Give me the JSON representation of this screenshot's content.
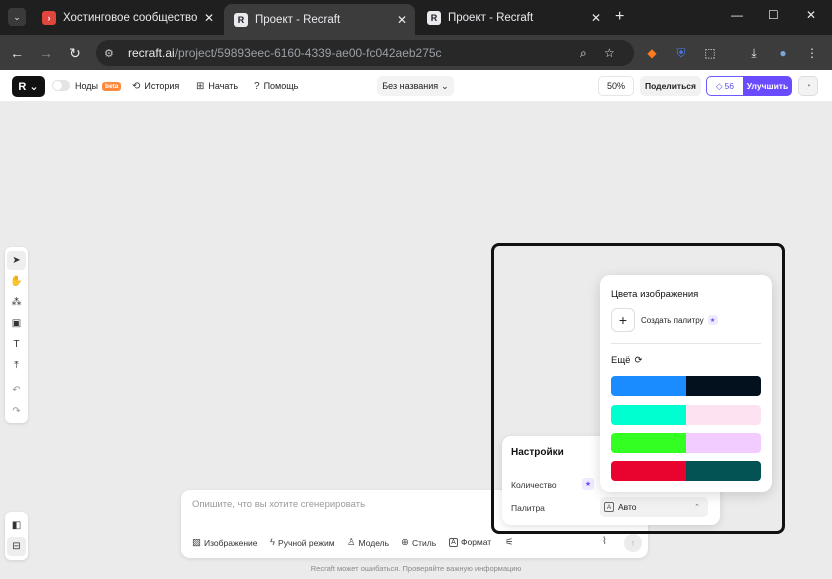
{
  "browser": {
    "menu_glyph": "⌄",
    "tabs": [
      {
        "title": "Хостинговое сообщество «Tim",
        "close": "✕",
        "favicon": "›"
      },
      {
        "title": "Проект - Recraft",
        "close": "✕",
        "favicon": "R"
      },
      {
        "title": "Проект - Recraft",
        "close": "✕",
        "favicon": "R"
      }
    ],
    "new_tab": "+",
    "window_controls": {
      "minimize": "—",
      "maximize": "☐",
      "close": "✕"
    },
    "nav": {
      "back": "←",
      "forward": "→",
      "reload": "↻"
    },
    "url_domain": "recraft.ai",
    "url_path": "/project/59893eec-6160-4339-ae00-fc042aeb275c",
    "omnibox_icons": {
      "site_info": "⚙",
      "zoom": "⌕",
      "bookmark": "☆"
    },
    "extension_icons": {
      "fox": "◆",
      "shield": "⛨",
      "puzzle": "⬚",
      "download": "⤓",
      "profile": "●",
      "menu": "⋮"
    }
  },
  "app": {
    "logo_glyph": "R",
    "logo_chevron": "⌄",
    "nodes_label": "Ноды",
    "beta_badge": "beta",
    "history_icon": "⟲",
    "history_label": "История",
    "start_icon": "⊞",
    "start_label": "Начать",
    "help_icon": "?",
    "help_label": "Помощь",
    "doc_title": "Без названия",
    "doc_chevron": "⌄",
    "zoom": "50%",
    "share_label": "Поделиться",
    "credits_icon": "◇",
    "credits": "56",
    "upgrade_label": "Улучшить",
    "avatar_icon": "◔"
  },
  "toolbar": {
    "tools": [
      {
        "name": "select",
        "glyph": "➤"
      },
      {
        "name": "hand",
        "glyph": "✋"
      },
      {
        "name": "shapes",
        "glyph": "⁂"
      },
      {
        "name": "frame",
        "glyph": "▣"
      },
      {
        "name": "text",
        "glyph": "T"
      },
      {
        "name": "upload",
        "glyph": "⤒"
      },
      {
        "name": "undo",
        "glyph": "↶"
      },
      {
        "name": "redo",
        "glyph": "↷"
      }
    ],
    "bottom_tools": [
      {
        "name": "layers",
        "glyph": "◧"
      },
      {
        "name": "panel",
        "glyph": "⊟"
      }
    ]
  },
  "prompt": {
    "placeholder": "Опишите, что вы хотите сгенерировать",
    "tools": [
      {
        "icon": "▨",
        "label": "Изображение"
      },
      {
        "icon": "ϟ",
        "label": "Ручной режим"
      },
      {
        "icon": "♙",
        "label": "Модель"
      },
      {
        "icon": "⊕",
        "label": "Стиль"
      },
      {
        "icon": "A",
        "label": "Формат"
      }
    ],
    "settings_icon": "⚟",
    "attach_icon": "⌇",
    "send_icon": "↑",
    "footer": "Recraft может ошибаться. Проверяйте важную информацию"
  },
  "settings_panel": {
    "title": "Настройки",
    "count_label": "Количество",
    "count_badge": "★",
    "palette_label": "Палитра",
    "palette_icon": "A",
    "palette_value": "Авто",
    "palette_chevron": "⌃"
  },
  "colors_popup": {
    "title": "Цвета изображения",
    "create_icon": "+",
    "create_label": "Создать палитру",
    "create_badge": "★",
    "more_label": "Ещё",
    "more_icon": "⟳",
    "palettes": [
      {
        "colors": [
          "#1a8cff",
          "#03111e"
        ]
      },
      {
        "colors": [
          "#00ffd0",
          "#fde3f2"
        ]
      },
      {
        "colors": [
          "#33ff22",
          "#f2ccff"
        ]
      },
      {
        "colors": [
          "#e8042f",
          "#035254"
        ]
      }
    ]
  },
  "colors": {
    "accent": "#6b4bff",
    "beta": "#ff8a3d",
    "highlight_frame": "#111111"
  }
}
